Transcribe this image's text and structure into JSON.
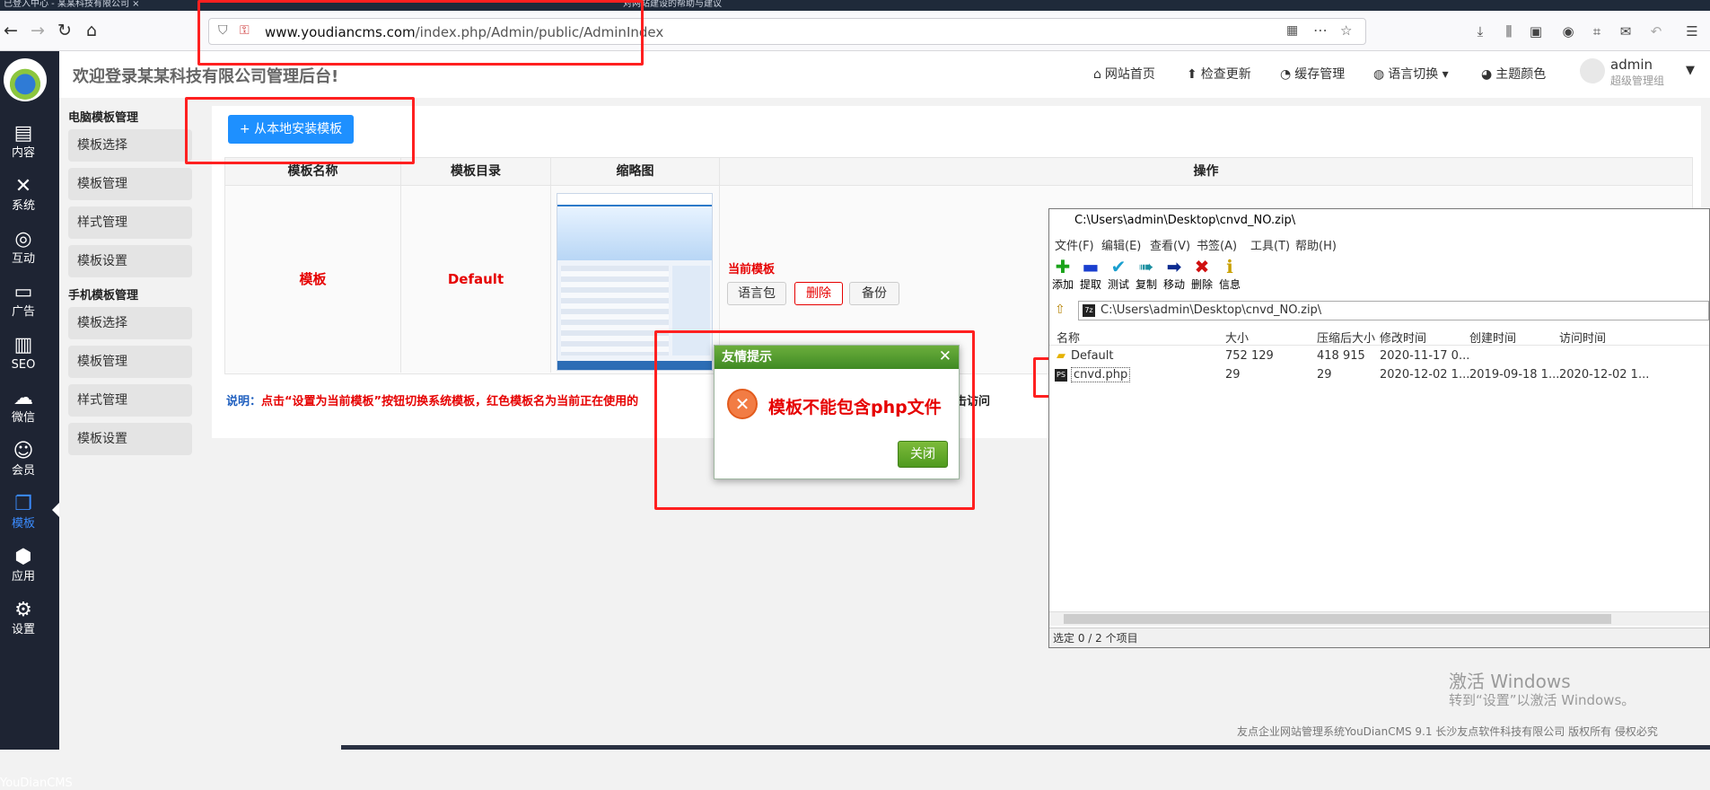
{
  "browser": {
    "tabs": [
      "已登入中心 - 某某科技有限公司 ×",
      "",
      "",
      "对网站建设的帮助与建议"
    ],
    "url_domain": "www.youdiancms.com",
    "url_path": "/index.php/Admin/public/AdminIndex"
  },
  "sidebar": {
    "items": [
      {
        "label": "内容",
        "icon": "content-icon"
      },
      {
        "label": "系统",
        "icon": "system-icon"
      },
      {
        "label": "互动",
        "icon": "interaction-icon"
      },
      {
        "label": "广告",
        "icon": "ad-icon"
      },
      {
        "label": "SEO",
        "icon": "seo-icon"
      },
      {
        "label": "微信",
        "icon": "wechat-icon"
      },
      {
        "label": "会员",
        "icon": "member-icon"
      },
      {
        "label": "模板",
        "icon": "template-icon",
        "active": true
      },
      {
        "label": "应用",
        "icon": "app-icon"
      },
      {
        "label": "设置",
        "icon": "settings-icon"
      }
    ],
    "footer": "YouDianCMS"
  },
  "header": {
    "welcome": "欢迎登录某某科技有限公司管理后台!",
    "nav": [
      "网站首页",
      "检查更新",
      "缓存管理",
      "语言切换",
      "主题颜色"
    ],
    "user": "admin",
    "role": "超级管理组"
  },
  "submenu": {
    "pc_title": "电脑模板管理",
    "pc_items": [
      "模板选择",
      "模板管理",
      "样式管理",
      "模板设置"
    ],
    "mobile_title": "手机模板管理",
    "mobile_items": [
      "模板选择",
      "模板管理",
      "样式管理",
      "模板设置"
    ]
  },
  "main": {
    "install_button": "+ 从本地安装模板",
    "columns": [
      "模板名称",
      "模板目录",
      "缩略图",
      "操作"
    ],
    "row": {
      "name": "模板",
      "dir": "Default",
      "current_label": "当前模板",
      "buttons": [
        "语言包",
        "删除",
        "备份"
      ]
    },
    "note_lead": "说明：",
    "note_text": "点击“设置为当前模板”按钮切换系统模板，红色模板名为当前正在使用的",
    "note_tail": "击访问"
  },
  "dialog": {
    "title": "友情提示",
    "message": "模板不能包含php文件",
    "button": "关闭"
  },
  "zip": {
    "title": "C:\\Users\\admin\\Desktop\\cnvd_NO.zip\\",
    "menu": [
      "文件(F)",
      "编辑(E)",
      "查看(V)",
      "书签(A)",
      "工具(T)",
      "帮助(H)"
    ],
    "tools": [
      {
        "label": "添加",
        "icon": "add-icon",
        "color": "#1aa31a"
      },
      {
        "label": "提取",
        "icon": "extract-icon",
        "color": "#1a3fcf"
      },
      {
        "label": "测试",
        "icon": "test-icon",
        "color": "#1a9fcf"
      },
      {
        "label": "复制",
        "icon": "copy-icon",
        "color": "#1a8fa0"
      },
      {
        "label": "移动",
        "icon": "move-icon",
        "color": "#0a2a8f"
      },
      {
        "label": "删除",
        "icon": "delete-icon",
        "color": "#d01010"
      },
      {
        "label": "信息",
        "icon": "info-icon",
        "color": "#c9a000"
      }
    ],
    "path": "C:\\Users\\admin\\Desktop\\cnvd_NO.zip\\",
    "columns": [
      "名称",
      "大小",
      "压缩后大小",
      "修改时间",
      "创建时间",
      "访问时间"
    ],
    "rows": [
      {
        "name": "Default",
        "size": "752 129",
        "packed": "418 915",
        "modified": "2020-11-17 0...",
        "created": "",
        "accessed": ""
      },
      {
        "name": "cnvd.php",
        "size": "29",
        "packed": "29",
        "modified": "2020-12-02 1...",
        "created": "2019-09-18 1...",
        "accessed": "2020-12-02 1..."
      }
    ],
    "status": "选定 0 / 2 个项目"
  },
  "windows": {
    "activate_title": "激活 Windows",
    "activate_hint": "转到“设置”以激活 Windows。"
  },
  "footer": "友点企业网站管理系统YouDianCMS 9.1  长沙友点软件科技有限公司 版权所有 侵权必究"
}
